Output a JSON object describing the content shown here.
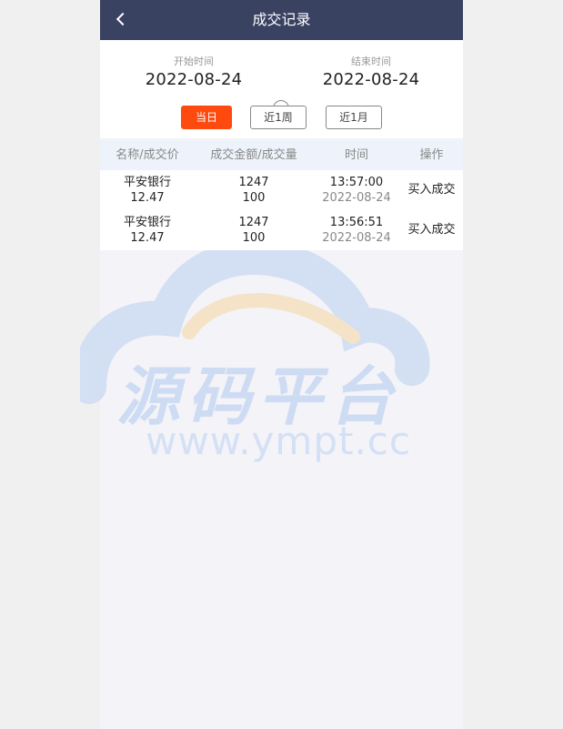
{
  "header": {
    "title": "成交记录",
    "back_icon": "chevron-left-icon"
  },
  "filters": {
    "start_label": "开始时间",
    "start_date": "2022-08-24",
    "end_label": "结束时间",
    "end_date": "2022-08-24",
    "swap_icon": "swap-icon",
    "ranges": [
      {
        "label": "当日",
        "active": true
      },
      {
        "label": "近1周",
        "active": false
      },
      {
        "label": "近1月",
        "active": false
      }
    ]
  },
  "table": {
    "columns": [
      "名称/成交价",
      "成交金额/成交量",
      "时间",
      "操作"
    ],
    "rows": [
      {
        "name": "平安银行",
        "price": "12.47",
        "amount": "1247",
        "volume": "100",
        "time": "13:57:00",
        "date": "2022-08-24",
        "op": "买入成交"
      },
      {
        "name": "平安银行",
        "price": "12.47",
        "amount": "1247",
        "volume": "100",
        "time": "13:56:51",
        "date": "2022-08-24",
        "op": "买入成交"
      }
    ]
  },
  "watermark": {
    "text": "源码平台",
    "url": "www.ympt.cc"
  },
  "colors": {
    "header_bg": "#3a4262",
    "accent": "#ff4a0f",
    "table_header_bg": "#eef3fb"
  }
}
